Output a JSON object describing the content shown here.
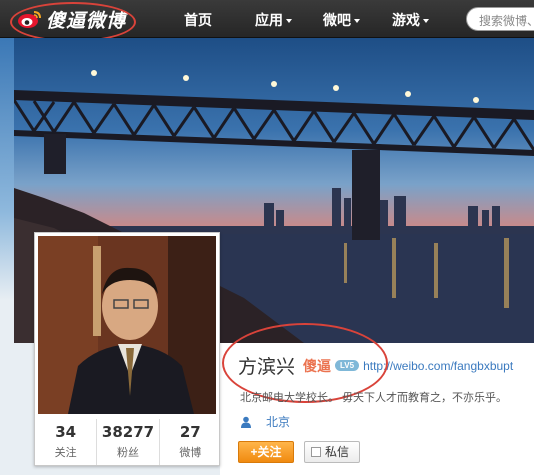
{
  "topbar": {
    "logo_text": "傻逼微博",
    "nav": [
      {
        "label": "首页",
        "has_caret": false
      },
      {
        "label": "应用",
        "has_caret": true
      },
      {
        "label": "微吧",
        "has_caret": true
      },
      {
        "label": "游戏",
        "has_caret": true
      }
    ],
    "search_placeholder": "搜索微博、"
  },
  "profile": {
    "name": "方滨兴",
    "brand_tag": "傻逼",
    "level": "LV5",
    "url": "http://weibo.com/fangbxbupt",
    "bio": "北京邮电大学校长。 毋天下人才而教育之，不亦乐乎。",
    "location": "北京",
    "follow_button": "关注",
    "message_button": "私信",
    "stats": [
      {
        "value": "34",
        "label": "关注"
      },
      {
        "value": "38277",
        "label": "粉丝"
      },
      {
        "value": "27",
        "label": "微博"
      }
    ]
  },
  "colors": {
    "annotation_ring": "#d9433a",
    "brand_orange": "#eb7350",
    "link_blue": "#3b7abf",
    "follow_orange": "#f08a10"
  }
}
